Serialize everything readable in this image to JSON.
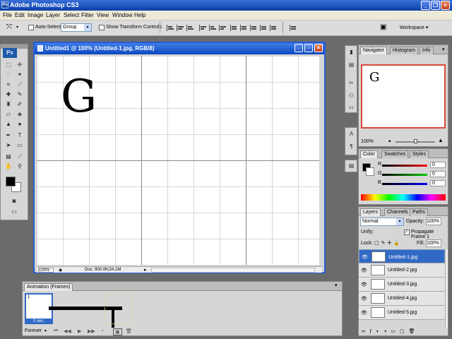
{
  "app": {
    "title": "Adobe Photoshop CS3",
    "logo": "Ps"
  },
  "menu": [
    "File",
    "Edit",
    "Image",
    "Layer",
    "Select",
    "Filter",
    "View",
    "Window",
    "Help"
  ],
  "options": {
    "auto_select_label": "Auto-Select:",
    "auto_select_value": "Group",
    "show_transform_label": "Show Transform Controls",
    "workspace_label": "Workspace ▾"
  },
  "document": {
    "title": "Untitled1 @ 100% (Untitled-1.jpg, RGB/8)",
    "canvas_letter": "G",
    "zoom": "100%",
    "doc_info": "Doc: 900.0K/24.1M"
  },
  "navigator": {
    "tabs": [
      "Navigator",
      "Histogram",
      "Info"
    ],
    "preview_letter": "G",
    "zoom": "100%"
  },
  "color": {
    "tabs": [
      "Color",
      "Swatches",
      "Styles"
    ],
    "channels": [
      {
        "label": "R",
        "value": "0"
      },
      {
        "label": "G",
        "value": "0"
      },
      {
        "label": "B",
        "value": "0"
      }
    ]
  },
  "layers": {
    "tabs": [
      "Layers",
      "Channels",
      "Paths"
    ],
    "blend_mode": "Normal",
    "opacity_label": "Opacity:",
    "opacity_value": "100%",
    "unify_label": "Unify:",
    "propagate_label": "Propagate Frame 1",
    "lock_label": "Lock:",
    "fill_label": "Fill:",
    "fill_value": "100%",
    "items": [
      {
        "name": "Untitled-1.jpg",
        "selected": true
      },
      {
        "name": "Untitled-2.jpg",
        "selected": false
      },
      {
        "name": "Untitled-3.jpg",
        "selected": false
      },
      {
        "name": "Untitled-4.jpg",
        "selected": false
      },
      {
        "name": "Untitled-5.jpg",
        "selected": false
      }
    ]
  },
  "animation": {
    "tab": "Animation (Frames)",
    "frame_number": "1",
    "frame_delay": "0 sec.",
    "loop": "Forever"
  },
  "colors": {
    "titlebar": "#0a3ea8",
    "selection": "#316ac5",
    "background": "#6b6b6b"
  },
  "icons": [
    "move-tool-icon",
    "marquee-icon",
    "lasso-icon",
    "crop-icon",
    "brush-icon",
    "eraser-icon",
    "pen-icon",
    "type-icon",
    "zoom-icon",
    "eye-icon"
  ]
}
